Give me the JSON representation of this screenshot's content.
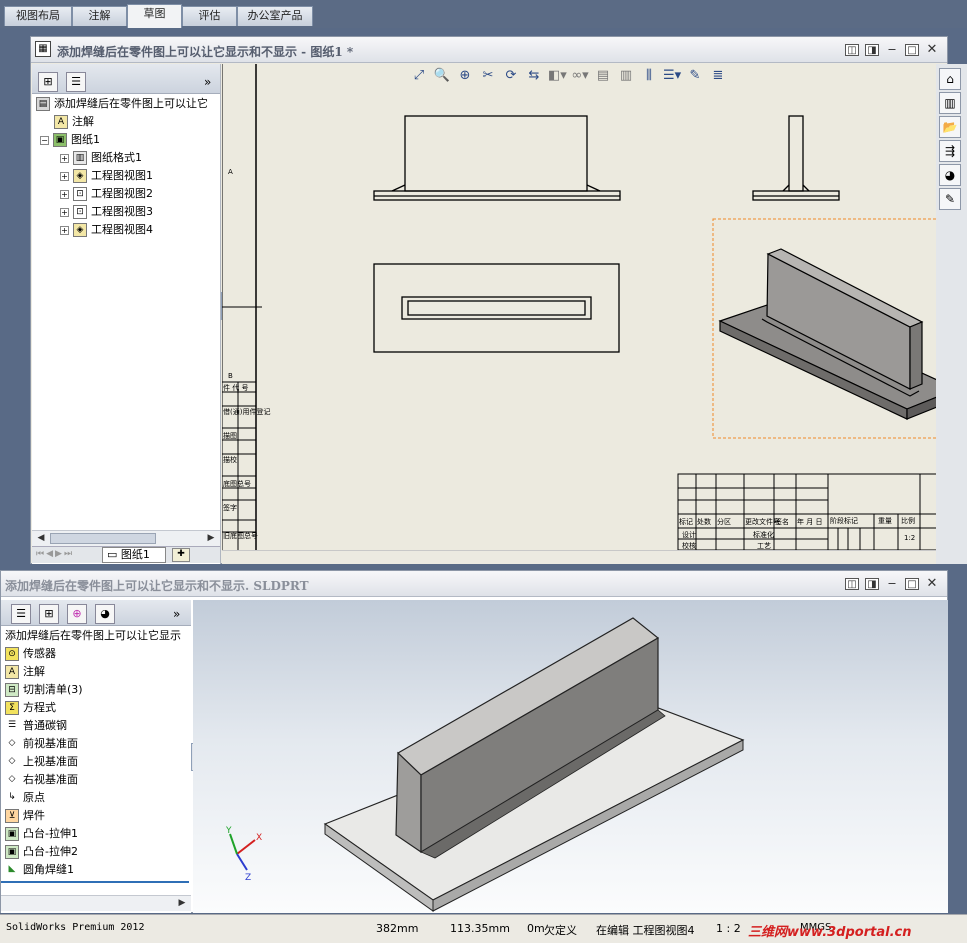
{
  "cmd_tabs": [
    "视图布局",
    "注解",
    "草图",
    "评估",
    "办公室产品"
  ],
  "drawing_window": {
    "title": "添加焊缝后在零件图上可以让它显示和不显示 - 图纸1 *",
    "tree": {
      "root": "添加焊缝后在零件图上可以让它",
      "items": [
        "注解",
        "图纸1",
        "图纸格式1",
        "工程图视图1",
        "工程图视图2",
        "工程图视图3",
        "工程图视图4"
      ]
    },
    "sheet_tab": "图纸1",
    "zone_letters": [
      "A",
      "B"
    ],
    "side_labels": [
      "件 代 号",
      "借(通)用件登记",
      "描图",
      "描校",
      "底图总号",
      "签字",
      "旧底图总号"
    ],
    "title_block": {
      "row1": [
        "标记",
        "处数",
        "分区",
        "更改文件号",
        "签名",
        "年 月 日"
      ],
      "row2": [
        "设计",
        "标准化"
      ],
      "row3": [
        "校核",
        "工艺"
      ],
      "stage": "阶段标记",
      "weight": "重量",
      "scale_label": "比例",
      "scale_value": "1:2"
    }
  },
  "part_window": {
    "title": "添加焊缝后在零件图上可以让它显示和不显示. SLDPRT",
    "tree": {
      "root": "添加焊缝后在零件图上可以让它显示",
      "items": [
        "传感器",
        "注解",
        "切割清单(3)",
        "方程式",
        "普通碳钢",
        "前视基准面",
        "上视基准面",
        "右视基准面",
        "原点",
        "焊件",
        "凸台-拉伸1",
        "凸台-拉伸2",
        "圆角焊缝1"
      ]
    },
    "triad": {
      "x": "X",
      "y": "Y",
      "z": "Z"
    }
  },
  "status": {
    "app": "SolidWorks Premium 2012",
    "x": "382mm",
    "y": "113.35mm",
    "z": "0m",
    "state": "欠定义",
    "editing": "在编辑 工程图视图4",
    "scale": "1 : 2",
    "units": "MMGS",
    "watermark": "三维网www.3dportal.cn"
  }
}
